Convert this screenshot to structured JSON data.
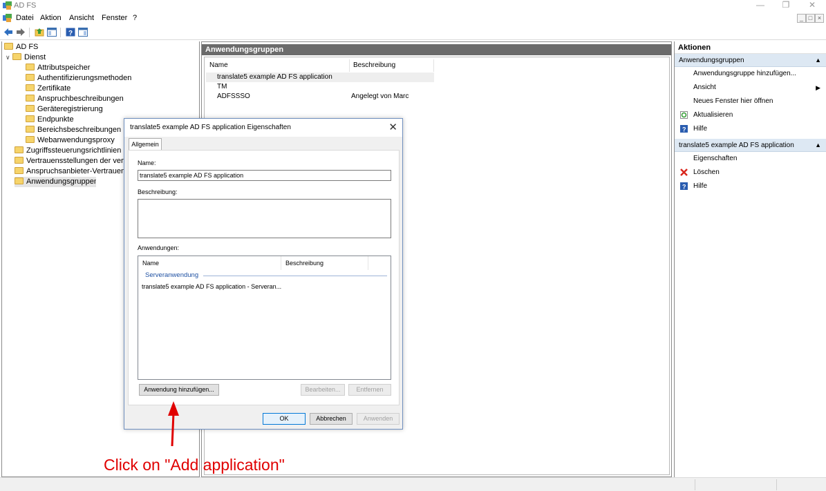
{
  "window": {
    "title": "AD FS"
  },
  "menu": {
    "items": [
      "Datei",
      "Aktion",
      "Ansicht",
      "Fenster",
      "?"
    ]
  },
  "tree": {
    "root": "AD FS",
    "items": [
      {
        "label": "Dienst",
        "level": 1,
        "expanded": true
      },
      {
        "label": "Attributspeicher",
        "level": 2
      },
      {
        "label": "Authentifizierungsmethoden",
        "level": 2
      },
      {
        "label": "Zertifikate",
        "level": 2
      },
      {
        "label": "Anspruchbeschreibungen",
        "level": 2
      },
      {
        "label": "Geräteregistrierung",
        "level": 2
      },
      {
        "label": "Endpunkte",
        "level": 2
      },
      {
        "label": "Bereichsbeschreibungen",
        "level": 2
      },
      {
        "label": "Webanwendungsproxy",
        "level": 2
      },
      {
        "label": "Zugriffssteuerungsrichtlinien",
        "level": 1
      },
      {
        "label": "Vertrauensstellungen der vertrauenden Seite",
        "level": 1
      },
      {
        "label": "Anspruchsanbieter-Vertrauensstellungen",
        "level": 1
      },
      {
        "label": "Anwendungsgruppen",
        "level": 1,
        "selected": true
      }
    ]
  },
  "center": {
    "header": "Anwendungsgruppen",
    "columns": [
      "Name",
      "Beschreibung"
    ],
    "rows": [
      {
        "name": "translate5 example AD FS application",
        "description": "",
        "selected": true
      },
      {
        "name": "TM",
        "description": ""
      },
      {
        "name": "ADFSSSO",
        "description": "Angelegt von Marc"
      }
    ]
  },
  "actions": {
    "header": "Aktionen",
    "section1": {
      "title": "Anwendungsgruppen",
      "items": [
        {
          "label": "Anwendungsgruppe hinzufügen...",
          "icon": ""
        },
        {
          "label": "Ansicht",
          "icon": "",
          "submenu": true
        },
        {
          "label": "Neues Fenster hier öffnen",
          "icon": ""
        },
        {
          "label": "Aktualisieren",
          "icon": "refresh-icon"
        },
        {
          "label": "Hilfe",
          "icon": "help-icon"
        }
      ]
    },
    "section2": {
      "title": "translate5 example AD FS application",
      "items": [
        {
          "label": "Eigenschaften",
          "icon": ""
        },
        {
          "label": "Löschen",
          "icon": "delete-icon"
        },
        {
          "label": "Hilfe",
          "icon": "help-icon"
        }
      ]
    }
  },
  "dialog": {
    "title": "translate5 example AD FS application Eigenschaften",
    "tab": "Allgemein",
    "name_label": "Name:",
    "name_value": "translate5 example AD FS application",
    "description_label": "Beschreibung:",
    "description_value": "",
    "applications_label": "Anwendungen:",
    "app_columns": [
      "Name",
      "Beschreibung"
    ],
    "app_group": "Serveranwendung",
    "app_rows": [
      "translate5 example AD FS application - Serveran..."
    ],
    "buttons": {
      "add": "Anwendung hinzufügen...",
      "edit": "Bearbeiten...",
      "remove": "Entfernen",
      "ok": "OK",
      "cancel": "Abbrechen",
      "apply": "Anwenden"
    }
  },
  "annotation": {
    "text": "Click on \"Add application\"",
    "color": "#e00000"
  }
}
